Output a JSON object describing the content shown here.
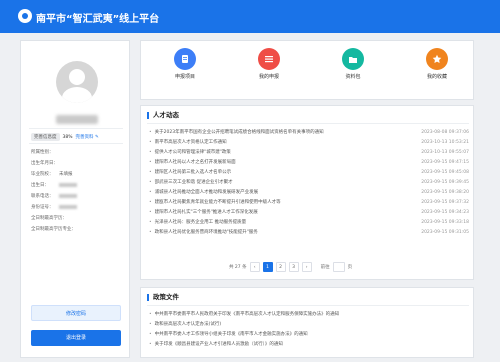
{
  "header": {
    "title": "南平市“智汇武夷”线上平台"
  },
  "profile": {
    "completeness_label": "完善信息度",
    "completeness_percent": "38%",
    "complete_link": "完善资料 ",
    "fields": [
      {
        "label": "所属性别：",
        "value": ""
      },
      {
        "label": "出生年月日：",
        "value": ""
      },
      {
        "label": "毕业院校：",
        "value": "未填报"
      },
      {
        "label": "出生日：",
        "value": ""
      },
      {
        "label": "联系电话：",
        "value": ""
      },
      {
        "label": "身份证号：",
        "value": ""
      },
      {
        "label": "全日制最高学历：",
        "value": ""
      },
      {
        "label": "全日制最高学历专业：",
        "value": ""
      }
    ],
    "edit_button": "修改密码",
    "logout_button": "退出登录"
  },
  "quick_links": [
    {
      "label": "申报项目",
      "color": "#3d7ef7",
      "icon": "document-icon"
    },
    {
      "label": "我的申报",
      "color": "#ef4d46",
      "icon": "list-icon"
    },
    {
      "label": "资料包",
      "color": "#14b8a0",
      "icon": "folder-icon"
    },
    {
      "label": "我的收藏",
      "color": "#f0841e",
      "icon": "star-icon"
    }
  ],
  "news": {
    "title": "人才动态",
    "items": [
      {
        "title": "关于2023年南平市国有企业公开招聘笔试成绩合格线和面试资格名单有关事项的通知",
        "date": "2023-08-08 09:37:06"
      },
      {
        "title": "南平市高层次人才资格认定工作通知",
        "date": "2023-10-13 10:53:21"
      },
      {
        "title": "提供人才公司和管理法律\"城市建\"政策",
        "date": "2023-10-13 09:55:07"
      },
      {
        "title": "建阳市人社局以人才之名打开发展新局面",
        "date": "2023-09-15 09:47:15"
      },
      {
        "title": "建阳区人社局第三批入选人才名单公示",
        "date": "2023-09-15 09:45:08"
      },
      {
        "title": "邵武县三次工业和谐 促进企业引才聚才",
        "date": "2023-09-15 09:39:45"
      },
      {
        "title": "浦城县人社局推动全面人才推动和发展研发产业发展",
        "date": "2023-09-15 09:38:20"
      },
      {
        "title": "建瓯市人社局聚焦青年就业能力不断提升引进和使用中级人才等",
        "date": "2023-09-15 09:37:32"
      },
      {
        "title": "建阳市人社局扎实\"三个服务\"推进人才工作深化发展",
        "date": "2023-09-15 09:34:23"
      },
      {
        "title": "光泽县人社局：服务企业用工 推动服务提质量",
        "date": "2023-09-15 09:33:18"
      },
      {
        "title": "政和县人社局优化服务营商环境推动\"技能提升\"服务",
        "date": "2023-09-15 09:31:05"
      }
    ]
  },
  "pager": {
    "total": "共 27 条",
    "prev": "‹",
    "pages": [
      "1",
      "2",
      "3"
    ],
    "next": "›",
    "goto_label": "前往",
    "page_suffix": "页"
  },
  "policy": {
    "title": "政策文件",
    "items": [
      {
        "title": "中共南平市委南平市人民政府关于印发《南平市高层次人才认定和服务保障实施办法》的通知",
        "date": ""
      },
      {
        "title": "政和县高层次人才认定办法(试行)",
        "date": ""
      },
      {
        "title": "中共南平市委人才工作领导小组关于印发《南平市人才金融实施办法》的通知",
        "date": ""
      },
      {
        "title": "关于印发《顺昌县建设产业人才引进和人员激励（试行）》的通知",
        "date": ""
      }
    ]
  }
}
